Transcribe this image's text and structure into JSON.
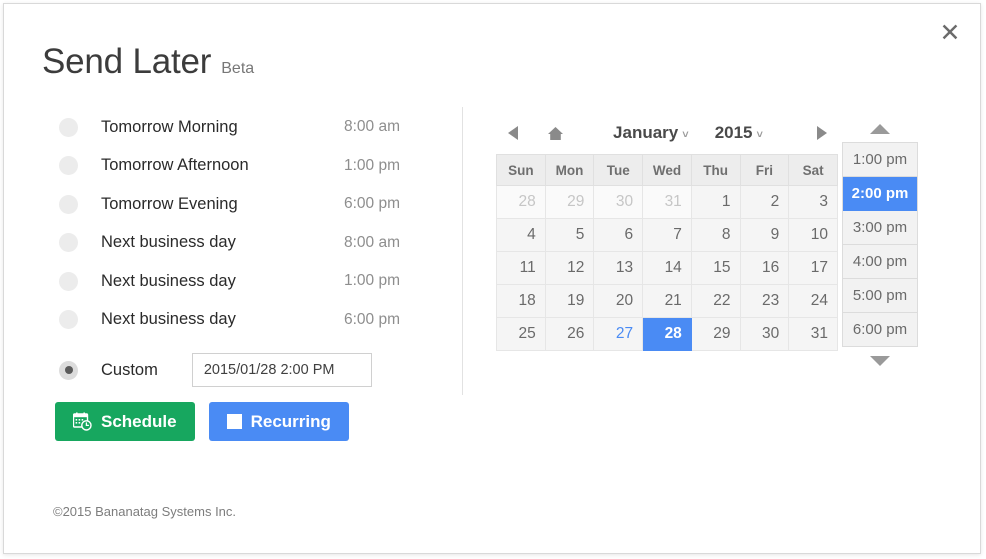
{
  "window": {
    "close_icon": "close-icon"
  },
  "header": {
    "title": "Send Later",
    "badge": "Beta"
  },
  "presets": {
    "options": [
      {
        "label": "Tomorrow Morning",
        "time": "8:00 am",
        "selected": false
      },
      {
        "label": "Tomorrow Afternoon",
        "time": "1:00 pm",
        "selected": false
      },
      {
        "label": "Tomorrow Evening",
        "time": "6:00 pm",
        "selected": false
      },
      {
        "label": "Next business day",
        "time": "8:00 am",
        "selected": false
      },
      {
        "label": "Next business day",
        "time": "1:00 pm",
        "selected": false
      },
      {
        "label": "Next business day",
        "time": "6:00 pm",
        "selected": false
      }
    ],
    "custom": {
      "label": "Custom",
      "selected": true,
      "value": "2015/01/28 2:00 PM",
      "placeholder": "2015/01/28 2:00 PM"
    }
  },
  "actions": {
    "schedule_label": "Schedule",
    "schedule_icon": "calendar-clock-icon",
    "schedule_color": "#17a75f",
    "recurring_label": "Recurring",
    "recurring_icon": "square-icon",
    "recurring_color": "#4a8bf4"
  },
  "calendar": {
    "prev_icon": "triangle-left-icon",
    "home_icon": "home-icon",
    "next_icon": "triangle-right-icon",
    "month": "January",
    "year": "2015",
    "month_caret": "˅",
    "year_caret": "˅",
    "weekdays": [
      "Sun",
      "Mon",
      "Tue",
      "Wed",
      "Thu",
      "Fri",
      "Sat"
    ],
    "weeks": [
      [
        {
          "d": "28",
          "cls": "other"
        },
        {
          "d": "29",
          "cls": "other"
        },
        {
          "d": "30",
          "cls": "other"
        },
        {
          "d": "31",
          "cls": "other"
        },
        {
          "d": "1",
          "cls": ""
        },
        {
          "d": "2",
          "cls": ""
        },
        {
          "d": "3",
          "cls": ""
        }
      ],
      [
        {
          "d": "4",
          "cls": ""
        },
        {
          "d": "5",
          "cls": ""
        },
        {
          "d": "6",
          "cls": ""
        },
        {
          "d": "7",
          "cls": ""
        },
        {
          "d": "8",
          "cls": ""
        },
        {
          "d": "9",
          "cls": ""
        },
        {
          "d": "10",
          "cls": ""
        }
      ],
      [
        {
          "d": "11",
          "cls": ""
        },
        {
          "d": "12",
          "cls": ""
        },
        {
          "d": "13",
          "cls": ""
        },
        {
          "d": "14",
          "cls": ""
        },
        {
          "d": "15",
          "cls": ""
        },
        {
          "d": "16",
          "cls": ""
        },
        {
          "d": "17",
          "cls": ""
        }
      ],
      [
        {
          "d": "18",
          "cls": ""
        },
        {
          "d": "19",
          "cls": ""
        },
        {
          "d": "20",
          "cls": ""
        },
        {
          "d": "21",
          "cls": ""
        },
        {
          "d": "22",
          "cls": ""
        },
        {
          "d": "23",
          "cls": ""
        },
        {
          "d": "24",
          "cls": ""
        }
      ],
      [
        {
          "d": "25",
          "cls": ""
        },
        {
          "d": "26",
          "cls": ""
        },
        {
          "d": "27",
          "cls": "today"
        },
        {
          "d": "28",
          "cls": "sel"
        },
        {
          "d": "29",
          "cls": ""
        },
        {
          "d": "30",
          "cls": ""
        },
        {
          "d": "31",
          "cls": ""
        }
      ]
    ],
    "selected_day": "28",
    "today_day": "27",
    "accent_color": "#4a8bf4"
  },
  "time_picker": {
    "scroll_up_icon": "triangle-up-icon",
    "scroll_down_icon": "triangle-down-icon",
    "times": [
      {
        "label": "1:00 pm",
        "selected": false
      },
      {
        "label": "2:00 pm",
        "selected": true
      },
      {
        "label": "3:00 pm",
        "selected": false
      },
      {
        "label": "4:00 pm",
        "selected": false
      },
      {
        "label": "5:00 pm",
        "selected": false
      },
      {
        "label": "6:00 pm",
        "selected": false
      }
    ],
    "selected_time": "2:00 pm"
  },
  "footer": {
    "copyright": "©2015 Bananatag Systems Inc."
  }
}
